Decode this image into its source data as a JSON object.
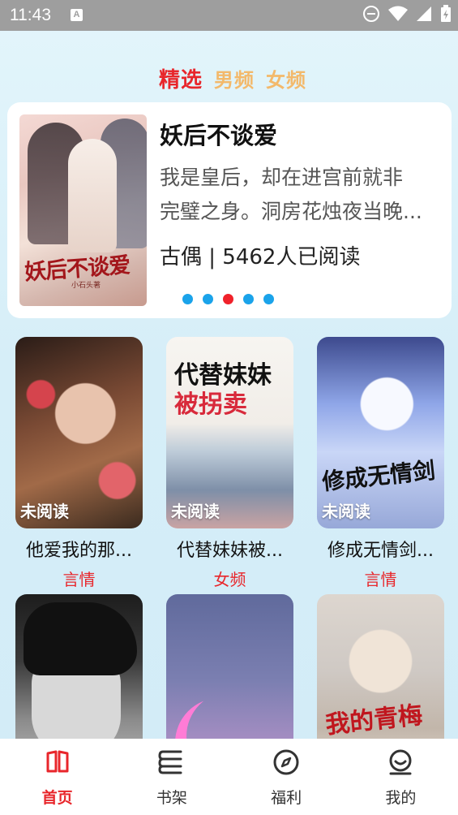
{
  "status_bar": {
    "time": "11:43",
    "notification_icon": "A"
  },
  "tabs": [
    {
      "label": "精选",
      "active": true
    },
    {
      "label": "男频",
      "active": false
    },
    {
      "label": "女频",
      "active": false
    }
  ],
  "banner": {
    "title": "妖后不谈爱",
    "description_line1": "我是皇后，却在进宫前就非",
    "description_line2": "完璧之身。洞房花烛夜当晚...",
    "meta": "古偶 | 5462人已阅读",
    "cover_title": "妖后不谈爱",
    "cover_author": "小石头著",
    "dot_count": 5,
    "active_dot": 2
  },
  "books": [
    {
      "title": "他爱我的那...",
      "tag": "言情",
      "badge": "未阅读"
    },
    {
      "title": "代替妹妹被...",
      "tag": "女频",
      "badge": "未阅读",
      "cover_text_1": "代替妹妹",
      "cover_text_2": "被拐卖"
    },
    {
      "title": "修成无情剑...",
      "tag": "言情",
      "badge": "未阅读",
      "cover_text": "修成无情剑"
    },
    {
      "title": "",
      "tag": "",
      "badge": ""
    },
    {
      "title": "",
      "tag": "",
      "badge": ""
    },
    {
      "title": "",
      "tag": "",
      "badge": "",
      "cover_text": "我的青梅"
    }
  ],
  "bottom_nav": [
    {
      "label": "首页",
      "icon": "book-open-icon",
      "active": true
    },
    {
      "label": "书架",
      "icon": "bookshelf-icon",
      "active": false
    },
    {
      "label": "福利",
      "icon": "compass-icon",
      "active": false
    },
    {
      "label": "我的",
      "icon": "profile-icon",
      "active": false
    }
  ],
  "colors": {
    "accent": "#e8262b",
    "tab_inactive": "#f3b96b",
    "dot": "#1aa3ea"
  }
}
